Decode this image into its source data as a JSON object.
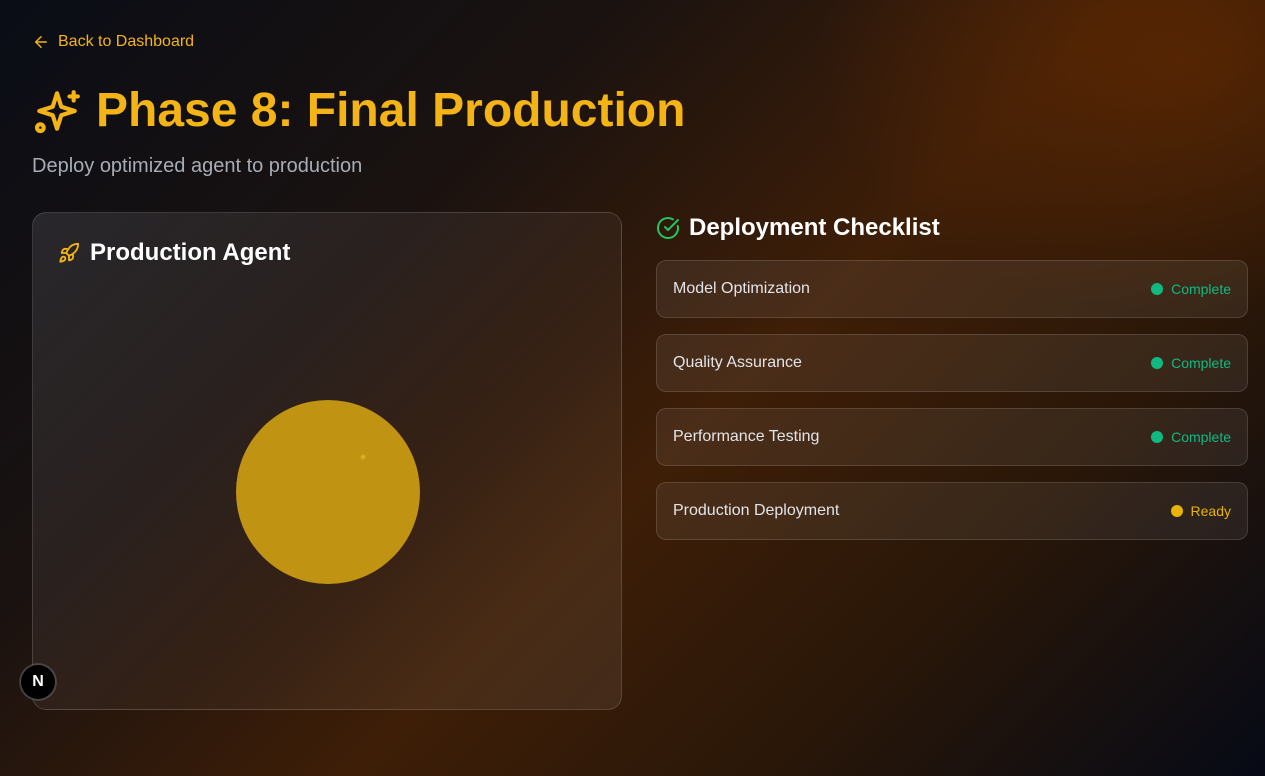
{
  "nav": {
    "back_label": "Back to Dashboard",
    "back_icon": "arrow-left-icon"
  },
  "header": {
    "icon": "sparkles-icon",
    "title": "Phase 8: Final Production",
    "subtitle": "Deploy optimized agent to production"
  },
  "agent_panel": {
    "icon": "rocket-icon",
    "title": "Production Agent",
    "orb_color": "#c09412"
  },
  "checklist": {
    "icon": "check-circle-icon",
    "title": "Deployment Checklist",
    "items": [
      {
        "label": "Model Optimization",
        "status": "Complete",
        "status_color": "#10b981"
      },
      {
        "label": "Quality Assurance",
        "status": "Complete",
        "status_color": "#10b981"
      },
      {
        "label": "Performance Testing",
        "status": "Complete",
        "status_color": "#10b981"
      },
      {
        "label": "Production Deployment",
        "status": "Ready",
        "status_color": "#eab308"
      }
    ]
  },
  "badge": {
    "letter": "N"
  },
  "colors": {
    "accent": "#f5b416",
    "complete": "#10b981",
    "ready": "#eab308"
  }
}
